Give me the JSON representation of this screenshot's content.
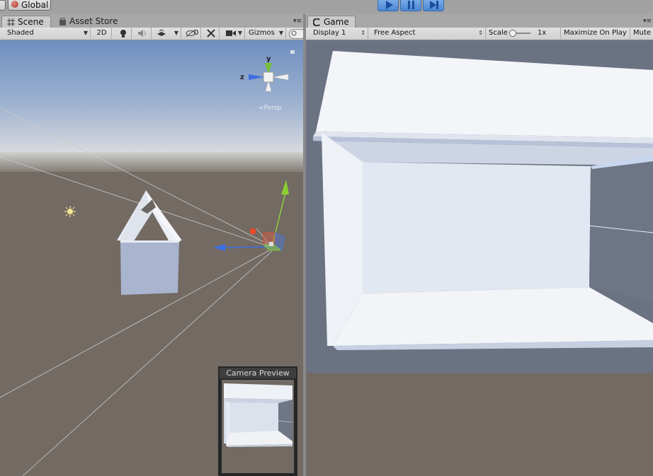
{
  "toolbar": {
    "global_label": "Global",
    "play_icon": "play-icon",
    "pause_icon": "pause-icon",
    "step_icon": "step-icon",
    "accent": "#4a86d4"
  },
  "scene_panel": {
    "tabs": [
      {
        "label": "Scene",
        "icon": "grid-icon",
        "active": true
      },
      {
        "label": "Asset Store",
        "icon": "shopping-bag-icon",
        "active": false
      }
    ],
    "options": {
      "shading": "Shaded",
      "mode_2d": "2D",
      "hidden_count": "0",
      "gizmos": "Gizmos"
    },
    "gizmo_axes": {
      "y": "y",
      "z": "z"
    }
  },
  "game_panel": {
    "tab_label": "Game",
    "display": "Display 1",
    "aspect": "Free Aspect",
    "scale_label": "Scale",
    "scale_value": 0.07,
    "scale_text": "1x",
    "maximize": "Maximize On Play",
    "mute": "Mute"
  },
  "camera_preview": {
    "title": "Camera Preview"
  },
  "colors": {
    "ground": "#726a63",
    "sky_top": "#6f8fc0",
    "game_bg": "#6b7383"
  }
}
